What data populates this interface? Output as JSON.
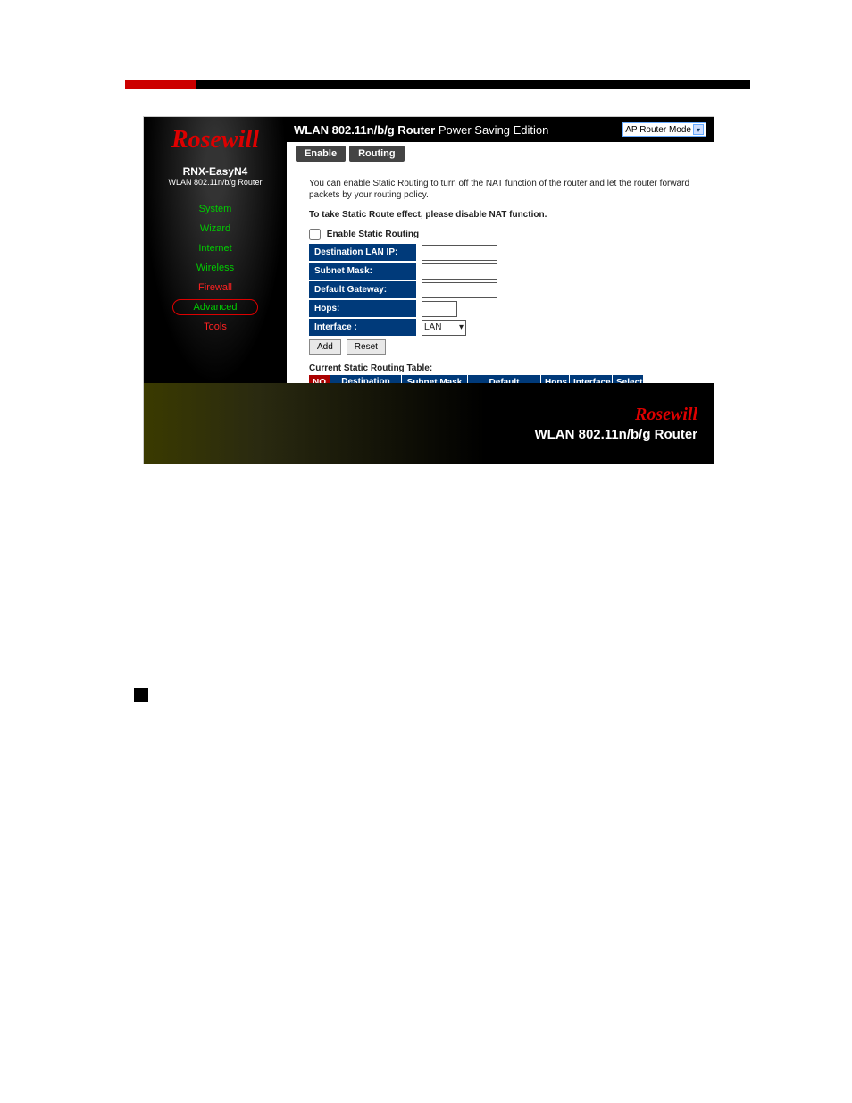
{
  "header": {
    "title_bold": "WLAN 802.11n/b/g Router",
    "title_plain": " Power Saving Edition",
    "mode": "AP Router Mode"
  },
  "sidebar": {
    "logo": "Rosewill",
    "model": "RNX-EasyN4",
    "model_sub": "WLAN 802.11n/b/g Router",
    "items": [
      {
        "label": "System",
        "cls": "nav-green"
      },
      {
        "label": "Wizard",
        "cls": "nav-green"
      },
      {
        "label": "Internet",
        "cls": "nav-green"
      },
      {
        "label": "Wireless",
        "cls": "nav-green"
      },
      {
        "label": "Firewall",
        "cls": "nav-red"
      },
      {
        "label": "Advanced",
        "cls": "nav-active"
      },
      {
        "label": "Tools",
        "cls": "nav-red"
      }
    ]
  },
  "tabs": [
    {
      "label": "Enable"
    },
    {
      "label": "Routing"
    }
  ],
  "content": {
    "desc": "You can enable Static Routing to turn off the NAT function of the router and let the router forward packets by your routing policy.",
    "note": "To take Static Route effect, please disable NAT function.",
    "checkbox_label": "Enable Static Routing",
    "fields": {
      "dest": "Destination LAN IP:",
      "subnet": "Subnet Mask:",
      "gateway": "Default Gateway:",
      "hops": "Hops:",
      "interface": "Interface :",
      "interface_value": "LAN"
    },
    "buttons": {
      "add": "Add",
      "reset": "Reset"
    },
    "table_title": "Current Static Routing Table:",
    "table_headers": {
      "no": "NO.",
      "dest": "Destination LAN IP",
      "sub": "Subnet Mask",
      "gw": "Default Gateway",
      "hops": "Hops",
      "if": "Interface",
      "sel": "Select"
    }
  },
  "footer": {
    "logo": "Rosewill",
    "text": "WLAN 802.11n/b/g Router"
  }
}
